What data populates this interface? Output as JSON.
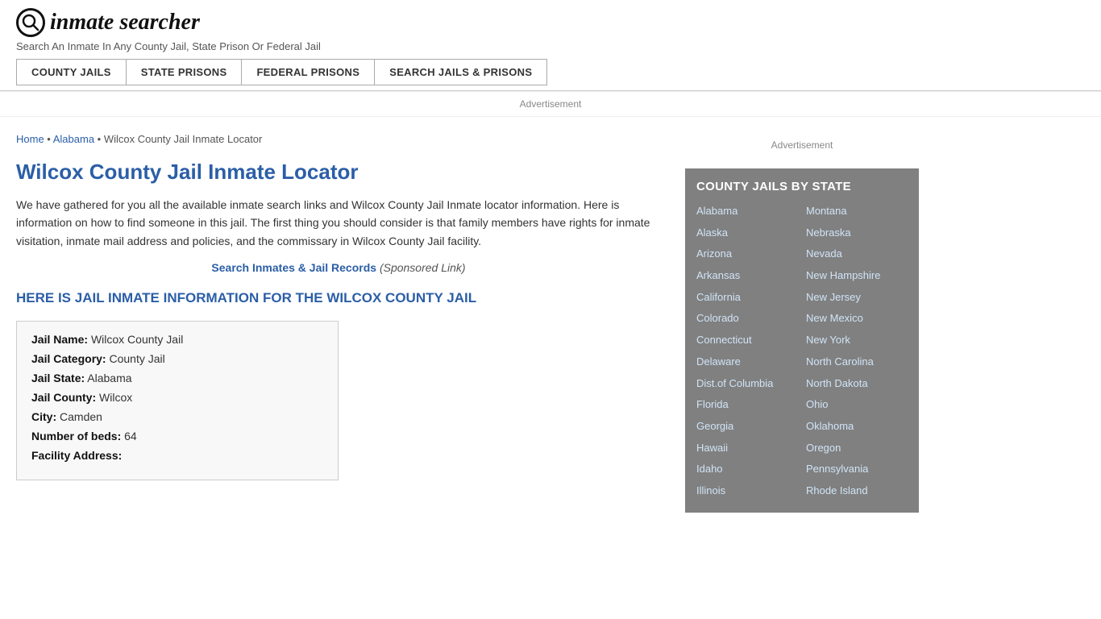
{
  "header": {
    "logo_icon": "🔍",
    "logo_text": "inmate searcher",
    "tagline": "Search An Inmate In Any County Jail, State Prison Or Federal Jail"
  },
  "nav": {
    "buttons": [
      "COUNTY JAILS",
      "STATE PRISONS",
      "FEDERAL PRISONS",
      "SEARCH JAILS & PRISONS"
    ]
  },
  "ad": {
    "label": "Advertisement"
  },
  "breadcrumb": {
    "home": "Home",
    "state": "Alabama",
    "current": "Wilcox County Jail Inmate Locator"
  },
  "page_title": "Wilcox County Jail Inmate Locator",
  "description": "We have gathered for you all the available inmate search links and Wilcox County Jail Inmate locator information. Here is information on how to find someone in this jail. The first thing you should consider is that family members have rights for inmate visitation, inmate mail address and policies, and the commissary in Wilcox County Jail facility.",
  "sponsored": {
    "link_text": "Search Inmates & Jail Records",
    "label": "(Sponsored Link)"
  },
  "section_heading": "HERE IS JAIL INMATE INFORMATION FOR THE WILCOX COUNTY JAIL",
  "info": {
    "jail_name_label": "Jail Name:",
    "jail_name": "Wilcox County Jail",
    "jail_category_label": "Jail Category:",
    "jail_category": "County Jail",
    "jail_state_label": "Jail State:",
    "jail_state": "Alabama",
    "jail_county_label": "Jail County:",
    "jail_county": "Wilcox",
    "city_label": "City:",
    "city": "Camden",
    "beds_label": "Number of beds:",
    "beds": "64",
    "address_label": "Facility Address:"
  },
  "sidebar": {
    "ad_label": "Advertisement",
    "state_box_title": "COUNTY JAILS BY STATE",
    "states_col1": [
      "Alabama",
      "Alaska",
      "Arizona",
      "Arkansas",
      "California",
      "Colorado",
      "Connecticut",
      "Delaware",
      "Dist.of Columbia",
      "Florida",
      "Georgia",
      "Hawaii",
      "Idaho",
      "Illinois"
    ],
    "states_col2": [
      "Montana",
      "Nebraska",
      "Nevada",
      "New Hampshire",
      "New Jersey",
      "New Mexico",
      "New York",
      "North Carolina",
      "North Dakota",
      "Ohio",
      "Oklahoma",
      "Oregon",
      "Pennsylvania",
      "Rhode Island"
    ]
  }
}
